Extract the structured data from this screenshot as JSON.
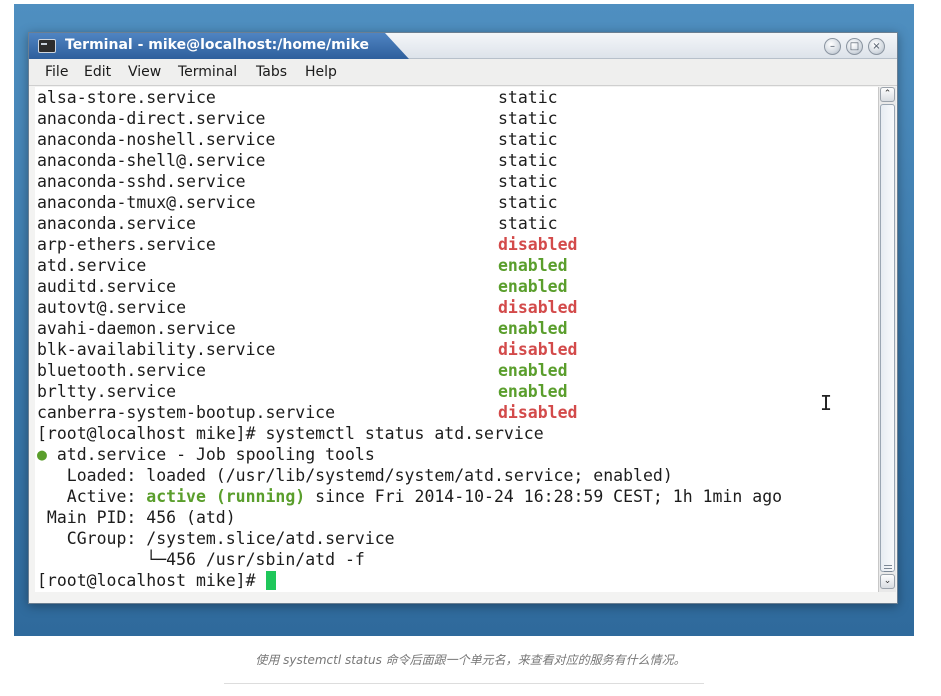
{
  "window": {
    "title": "Terminal - mike@localhost:/home/mike",
    "buttons": {
      "minimize": "–",
      "maximize": "□",
      "close": "×"
    }
  },
  "menu": [
    "File",
    "Edit",
    "View",
    "Terminal",
    "Tabs",
    "Help"
  ],
  "terminal": {
    "unit_list": [
      {
        "unit": "alsa-store.service",
        "state": "static"
      },
      {
        "unit": "anaconda-direct.service",
        "state": "static"
      },
      {
        "unit": "anaconda-noshell.service",
        "state": "static"
      },
      {
        "unit": "anaconda-shell@.service",
        "state": "static"
      },
      {
        "unit": "anaconda-sshd.service",
        "state": "static"
      },
      {
        "unit": "anaconda-tmux@.service",
        "state": "static"
      },
      {
        "unit": "anaconda.service",
        "state": "static"
      },
      {
        "unit": "arp-ethers.service",
        "state": "disabled"
      },
      {
        "unit": "atd.service",
        "state": "enabled"
      },
      {
        "unit": "auditd.service",
        "state": "enabled"
      },
      {
        "unit": "autovt@.service",
        "state": "disabled"
      },
      {
        "unit": "avahi-daemon.service",
        "state": "enabled"
      },
      {
        "unit": "blk-availability.service",
        "state": "disabled"
      },
      {
        "unit": "bluetooth.service",
        "state": "enabled"
      },
      {
        "unit": "brltty.service",
        "state": "enabled"
      },
      {
        "unit": "canberra-system-bootup.service",
        "state": "disabled"
      }
    ],
    "command_line": "[root@localhost mike]# systemctl status atd.service",
    "status": {
      "dot": "●",
      "header": " atd.service - Job spooling tools",
      "loaded": "   Loaded: loaded (/usr/lib/systemd/system/atd.service; enabled)",
      "active_prefix": "   Active: ",
      "active_state": "active (running)",
      "active_suffix": " since Fri 2014-10-24 16:28:59 CEST; 1h 1min ago",
      "main_pid": " Main PID: 456 (atd)",
      "cgroup": "   CGroup: /system.slice/atd.service",
      "cgroup_child": "           └─456 /usr/sbin/atd -f"
    },
    "prompt": "[root@localhost mike]# "
  },
  "scrollbar": {
    "up": "⌃",
    "down": "⌄"
  },
  "caption": "使用 systemctl status 命令后面跟一个单元名，来查看对应的服务有什么情况。",
  "colors": {
    "enabled": "#5a9e2c",
    "disabled": "#d34a4a",
    "cursor": "#1fc75a",
    "title_bar": "#2e5f9c"
  }
}
